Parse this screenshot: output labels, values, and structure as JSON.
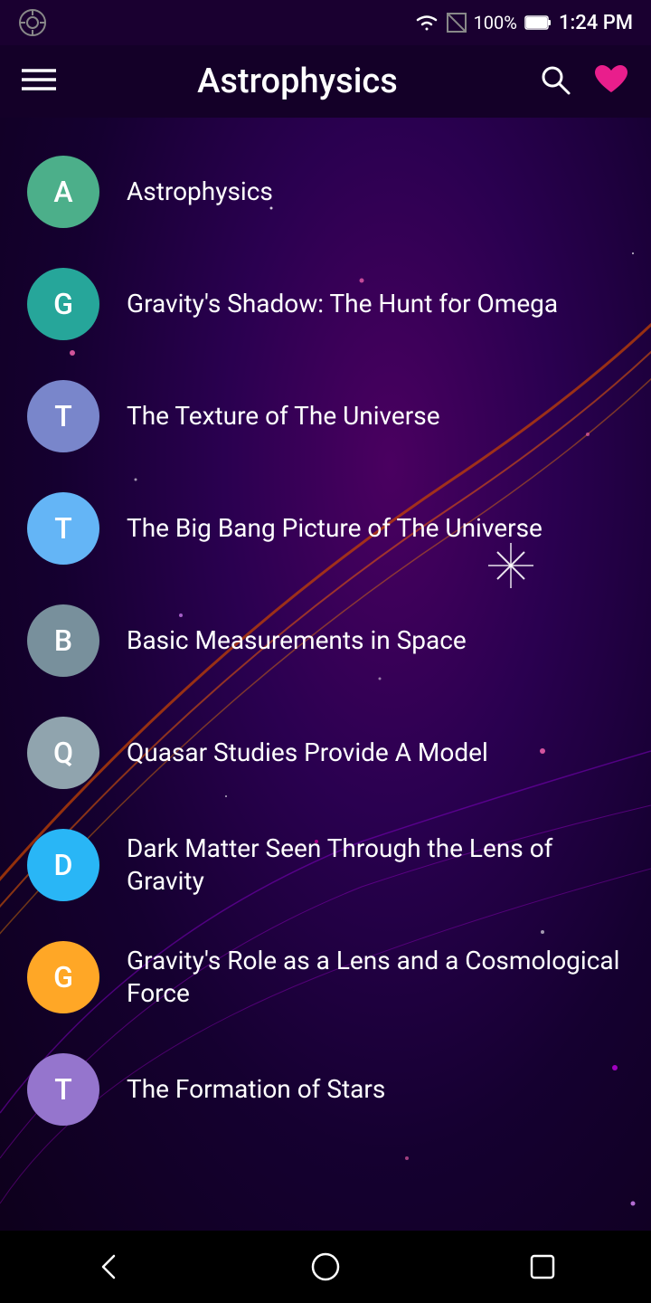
{
  "status": {
    "time": "1:24 PM",
    "battery": "100%",
    "signal": "●"
  },
  "header": {
    "title": "Astrophysics",
    "menu_label": "☰",
    "search_label": "search",
    "favorite_label": "favorite"
  },
  "items": [
    {
      "id": 1,
      "letter": "A",
      "title": "Astrophysics",
      "color": "#4caf8a"
    },
    {
      "id": 2,
      "letter": "G",
      "title": "Gravity's Shadow: The Hunt for Omega",
      "color": "#26a69a"
    },
    {
      "id": 3,
      "letter": "T",
      "title": "The Texture of The Universe",
      "color": "#7986cb"
    },
    {
      "id": 4,
      "letter": "T",
      "title": "The Big Bang Picture of The Universe",
      "color": "#64b5f6"
    },
    {
      "id": 5,
      "letter": "B",
      "title": "Basic Measurements in Space",
      "color": "#78909c"
    },
    {
      "id": 6,
      "letter": "Q",
      "title": "Quasar Studies Provide A Model",
      "color": "#90a4ae"
    },
    {
      "id": 7,
      "letter": "D",
      "title": "Dark Matter Seen Through the Lens of Gravity",
      "color": "#29b6f6"
    },
    {
      "id": 8,
      "letter": "G",
      "title": "Gravity's Role as a Lens and a Cosmological Force",
      "color": "#ffa726"
    },
    {
      "id": 9,
      "letter": "T",
      "title": "The Formation of Stars",
      "color": "#9575cd"
    }
  ],
  "nav": {
    "back": "◁",
    "home": "○",
    "recent": "□"
  }
}
